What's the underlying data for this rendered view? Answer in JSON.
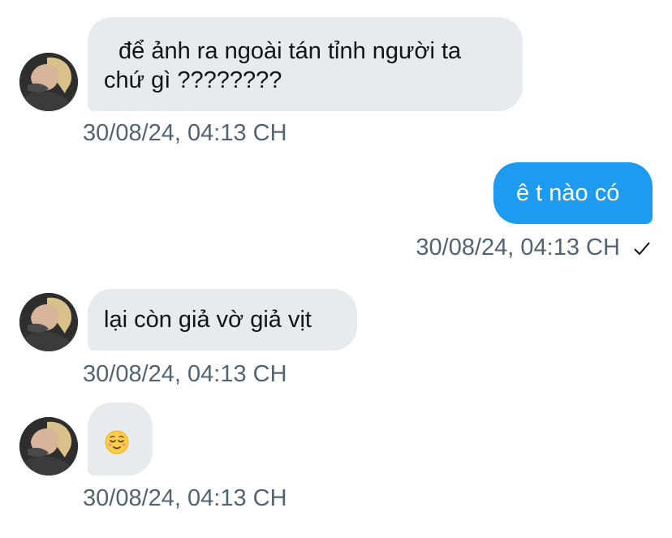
{
  "conversation": {
    "messages": [
      {
        "direction": "incoming",
        "line1": "để ảnh ra ngoài tán tỉnh người ta",
        "line2": "chứ gì ????????",
        "timestamp": "30/08/24, 04:13 CH"
      },
      {
        "direction": "outgoing",
        "text": "ê t nào có",
        "timestamp": "30/08/24, 04:13 CH",
        "status_icon": "checkmark-icon"
      },
      {
        "direction": "incoming",
        "text": "lại còn giả vờ giả vịt",
        "timestamp": "30/08/24, 04:13 CH"
      },
      {
        "direction": "incoming",
        "emoji": "relieved-face-emoji",
        "timestamp": "30/08/24, 04:13 CH"
      }
    ]
  },
  "colors": {
    "incoming_bubble": "#e7ebee",
    "outgoing_bubble": "#1d9bf0",
    "timestamp_text": "#536471",
    "message_text": "#0f1419"
  }
}
